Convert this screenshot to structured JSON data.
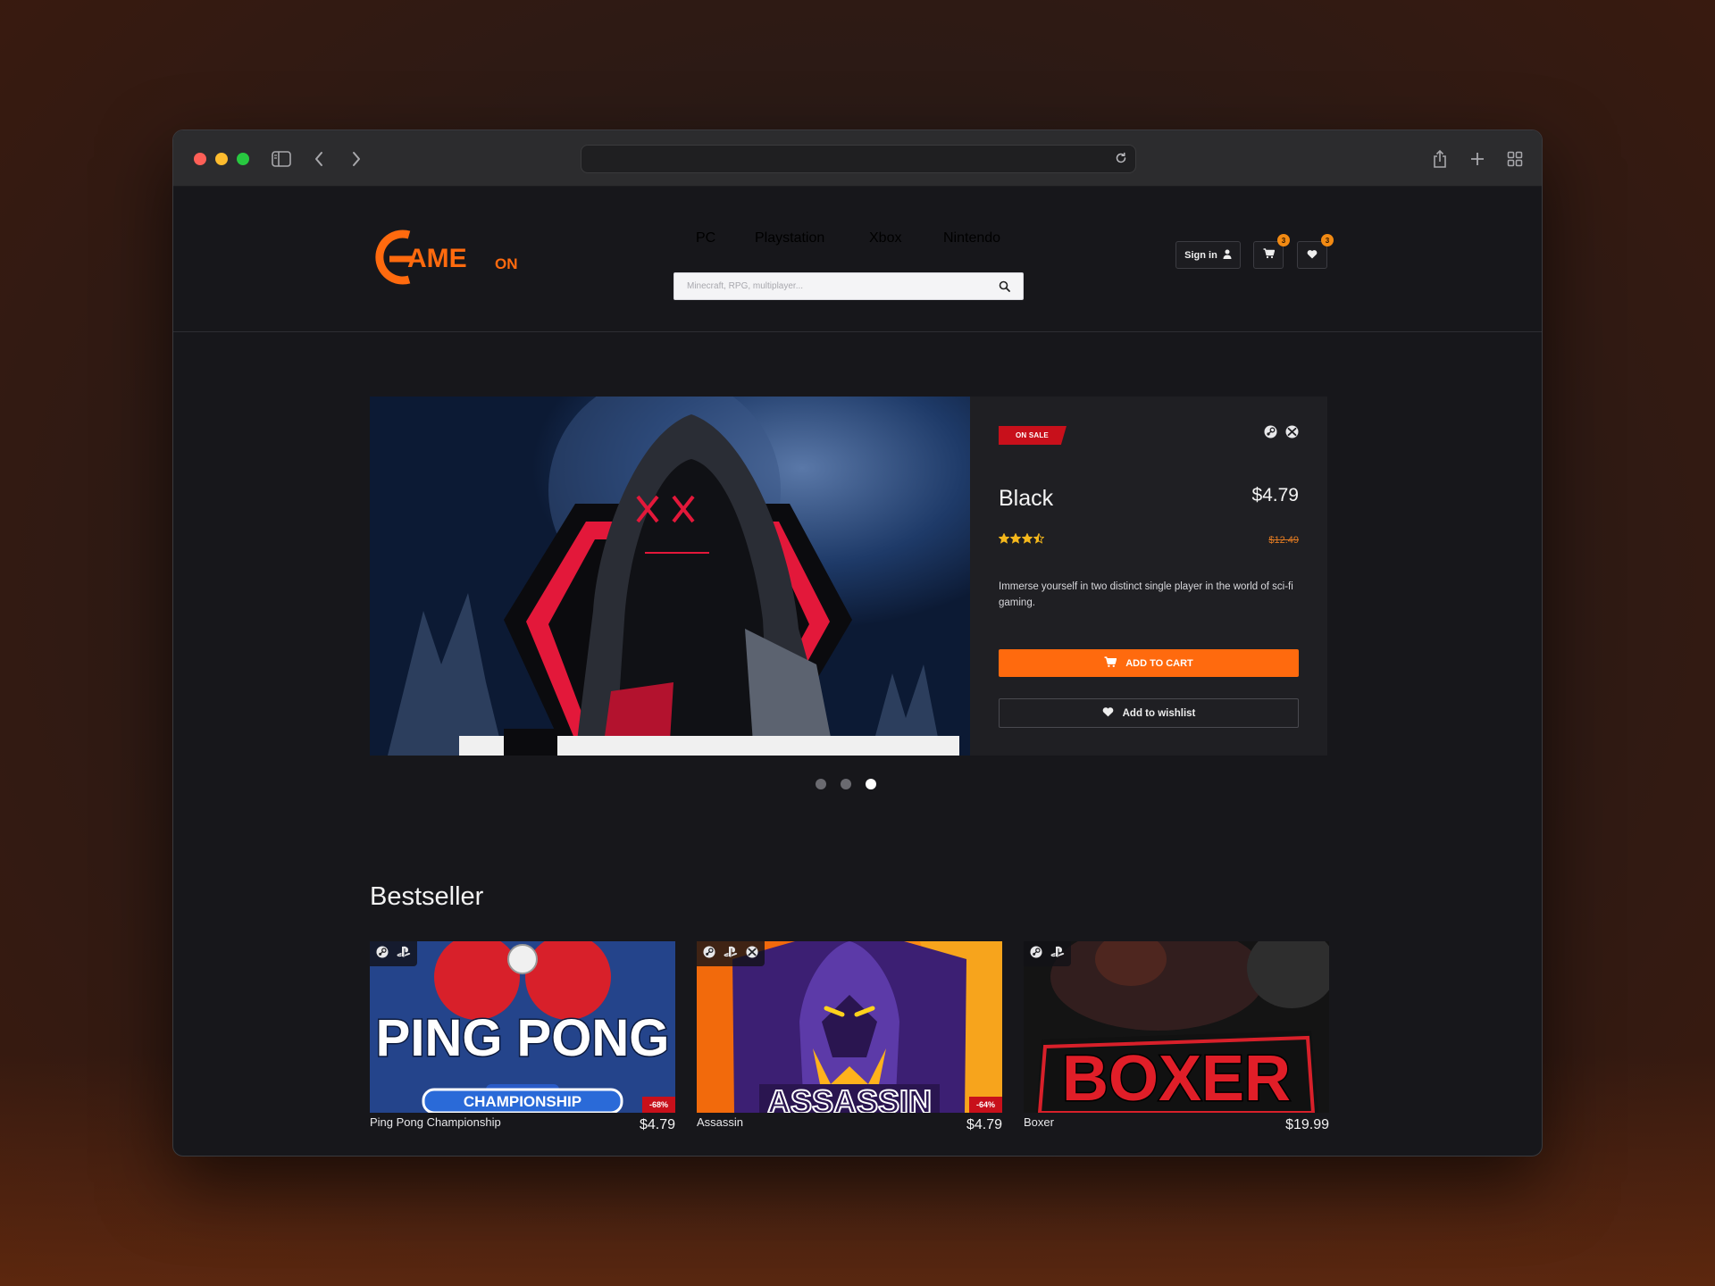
{
  "site": {
    "logo_main": "AME",
    "logo_suffix": "ON",
    "nav": [
      "PC",
      "Playstation",
      "Xbox",
      "Nintendo"
    ],
    "search_placeholder": "Minecraft, RPG, multiplayer...",
    "sign_in": "Sign in",
    "cart_count": "3",
    "wishlist_count": "3"
  },
  "hero": {
    "tag": "ON SALE",
    "title": "Black",
    "price": "$4.79",
    "old_price": "$12.49",
    "rating": 3.5,
    "description": "Immerse yourself in two distinct single player in the world of sci-fi gaming.",
    "add_to_cart": "ADD TO CART",
    "add_to_wishlist": "Add to wishlist",
    "platforms": [
      "steam-icon",
      "xbox-icon"
    ],
    "slides": 3,
    "active_slide": 3
  },
  "bestseller": {
    "title": "Bestseller",
    "items": [
      {
        "name": "Ping Pong Championship",
        "price": "$4.79",
        "discount": "-68%",
        "art_text": "PING PONG",
        "art_sub": "CHAMPIONSHIP",
        "platforms": [
          "steam-icon",
          "playstation-icon"
        ]
      },
      {
        "name": "Assassin",
        "price": "$4.79",
        "discount": "-64%",
        "art_text": "ASSASSIN",
        "platforms": [
          "steam-icon",
          "playstation-icon",
          "xbox-icon"
        ]
      },
      {
        "name": "Boxer",
        "price": "$19.99",
        "discount": "",
        "art_text": "BOXER",
        "platforms": [
          "steam-icon",
          "playstation-icon"
        ]
      }
    ]
  },
  "colors": {
    "accent": "#ff6a0e",
    "sale": "#c8101b",
    "badge": "#f28a13",
    "background": "#17171b"
  }
}
